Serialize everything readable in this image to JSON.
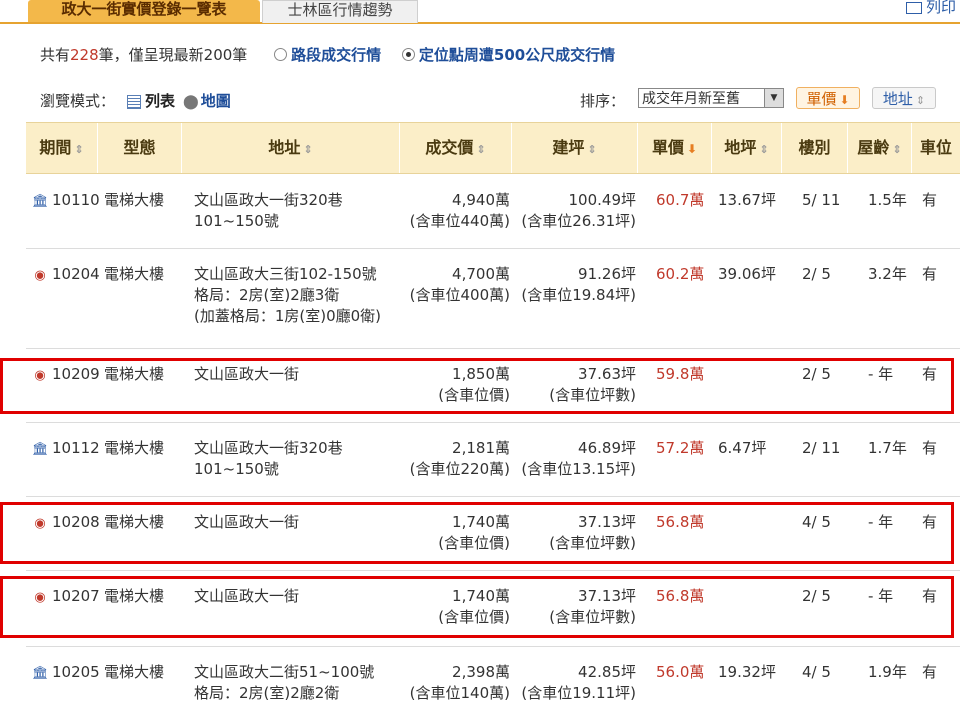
{
  "tabs": [
    "政大一街實價登錄一覽表",
    "士林區行情趨勢"
  ],
  "print_label": "列印",
  "summary": {
    "prefix": "共有",
    "count": "228",
    "suffix": "筆，僅呈現最新200筆",
    "option1": "路段成交行情",
    "option2": "定位點周遭500公尺成交行情"
  },
  "browse": {
    "label": "瀏覽模式：",
    "list": "列表",
    "map": "地圖"
  },
  "sort": {
    "label": "排序：",
    "selected": "成交年月新至舊",
    "price_btn": "單價",
    "addr_btn": "地址"
  },
  "columns": [
    "期間",
    "型態",
    "地址",
    "成交價",
    "建坪",
    "單價",
    "地坪",
    "樓別",
    "屋齡",
    "車位"
  ],
  "rows": [
    {
      "icon": "bank-icon",
      "period": "10110",
      "type": "電梯大樓",
      "addr": [
        "文山區政大一街320巷",
        "101~150號"
      ],
      "price": [
        "4,940萬",
        "(含車位440萬)"
      ],
      "area": [
        "100.49坪",
        "(含車位26.31坪)"
      ],
      "unit": "60.7萬",
      "land": "13.67坪",
      "floor": "5/ 11",
      "age": "1.5年",
      "park": "有"
    },
    {
      "icon": "target-icon",
      "period": "10204",
      "type": "電梯大樓",
      "addr": [
        "文山區政大三街102-150號",
        "格局：2房(室)2廳3衛",
        "(加蓋格局：1房(室)0廳0衛)"
      ],
      "price": [
        "4,700萬",
        "(含車位400萬)"
      ],
      "area": [
        "91.26坪",
        "(含車位19.84坪)"
      ],
      "unit": "60.2萬",
      "land": "39.06坪",
      "floor": "2/ 5",
      "age": "3.2年",
      "park": "有"
    },
    {
      "icon": "target-icon",
      "period": "10209",
      "type": "電梯大樓",
      "addr": [
        "文山區政大一街"
      ],
      "price": [
        "1,850萬",
        "(含車位價)"
      ],
      "area": [
        "37.63坪",
        "(含車位坪數)"
      ],
      "unit": "59.8萬",
      "land": "",
      "floor": "2/ 5",
      "age": "- 年",
      "park": "有"
    },
    {
      "icon": "bank-icon",
      "period": "10112",
      "type": "電梯大樓",
      "addr": [
        "文山區政大一街320巷",
        "101~150號"
      ],
      "price": [
        "2,181萬",
        "(含車位220萬)"
      ],
      "area": [
        "46.89坪",
        "(含車位13.15坪)"
      ],
      "unit": "57.2萬",
      "land": "6.47坪",
      "floor": "2/ 11",
      "age": "1.7年",
      "park": "有"
    },
    {
      "icon": "target-icon",
      "period": "10208",
      "type": "電梯大樓",
      "addr": [
        "文山區政大一街"
      ],
      "price": [
        "1,740萬",
        "(含車位價)"
      ],
      "area": [
        "37.13坪",
        "(含車位坪數)"
      ],
      "unit": "56.8萬",
      "land": "",
      "floor": "4/ 5",
      "age": "- 年",
      "park": "有"
    },
    {
      "icon": "target-icon",
      "period": "10207",
      "type": "電梯大樓",
      "addr": [
        "文山區政大一街"
      ],
      "price": [
        "1,740萬",
        "(含車位價)"
      ],
      "area": [
        "37.13坪",
        "(含車位坪數)"
      ],
      "unit": "56.8萬",
      "land": "",
      "floor": "2/ 5",
      "age": "- 年",
      "park": "有"
    },
    {
      "icon": "bank-icon",
      "period": "10205",
      "type": "電梯大樓",
      "addr": [
        "文山區政大二街51~100號",
        "格局：2房(室)2廳2衛"
      ],
      "price": [
        "2,398萬",
        "(含車位140萬)"
      ],
      "area": [
        "42.85坪",
        "(含車位19.11坪)"
      ],
      "unit": "56.0萬",
      "land": "19.32坪",
      "floor": "4/ 5",
      "age": "1.9年",
      "park": "有"
    }
  ]
}
